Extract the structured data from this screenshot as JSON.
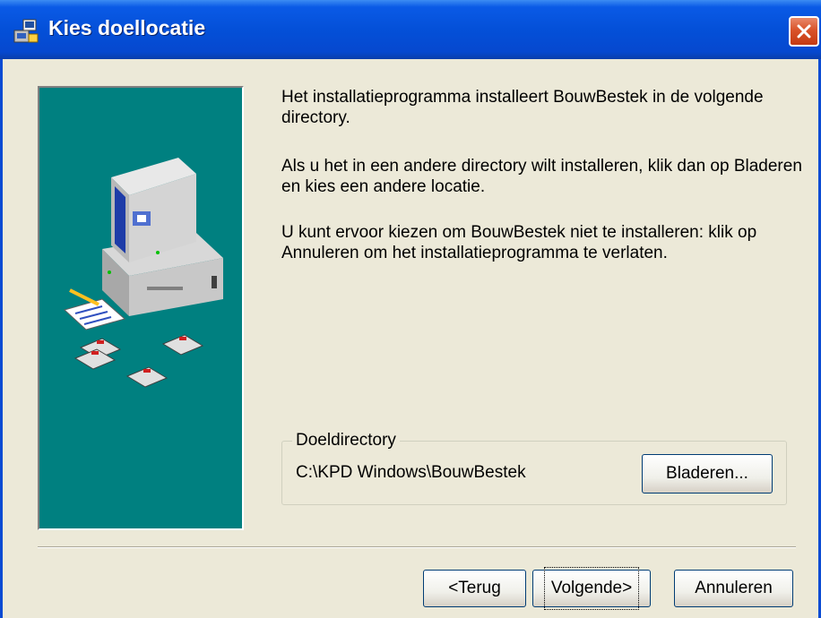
{
  "window": {
    "title": "Kies doellocatie",
    "icon": "setup-icon",
    "close_icon": "close-icon"
  },
  "content": {
    "paragraphs": [
      "Het installatieprogramma installeert BouwBestek in de volgende directory.",
      "Als u het in een andere directory wilt installeren, klik dan op Bladeren en kies een andere locatie.",
      "U kunt ervoor kiezen om BouwBestek niet te installeren: klik op Annuleren om het installatieprogramma te verlaten."
    ],
    "destination": {
      "group_label": "Doeldirectory",
      "path": "C:\\KPD Windows\\BouwBestek",
      "browse_label": "Bladeren..."
    }
  },
  "buttons": {
    "back": "<Terug",
    "next": "Volgende>",
    "cancel": "Annuleren"
  },
  "colors": {
    "titlebar": "#0450D8",
    "dialog_bg": "#ECE9D8",
    "side_panel": "#008080",
    "close_button": "#D9532A"
  }
}
